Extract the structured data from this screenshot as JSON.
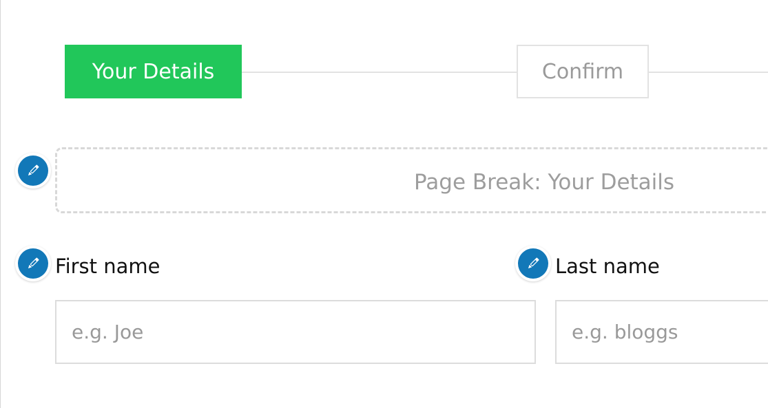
{
  "steps": {
    "active_label": "Your Details",
    "inactive_label": "Confirm"
  },
  "page_break": {
    "label": "Page Break: Your Details"
  },
  "fields": {
    "first_name": {
      "label": "First name",
      "placeholder": "e.g. Joe",
      "value": ""
    },
    "last_name": {
      "label": "Last name",
      "placeholder": "e.g. bloggs",
      "value": ""
    }
  },
  "icons": {
    "edit": "pencil-icon"
  },
  "colors": {
    "active_step": "#21c75a",
    "edit_badge": "#1278b8",
    "placeholder_text": "#999999",
    "border": "#dcdcdc"
  }
}
